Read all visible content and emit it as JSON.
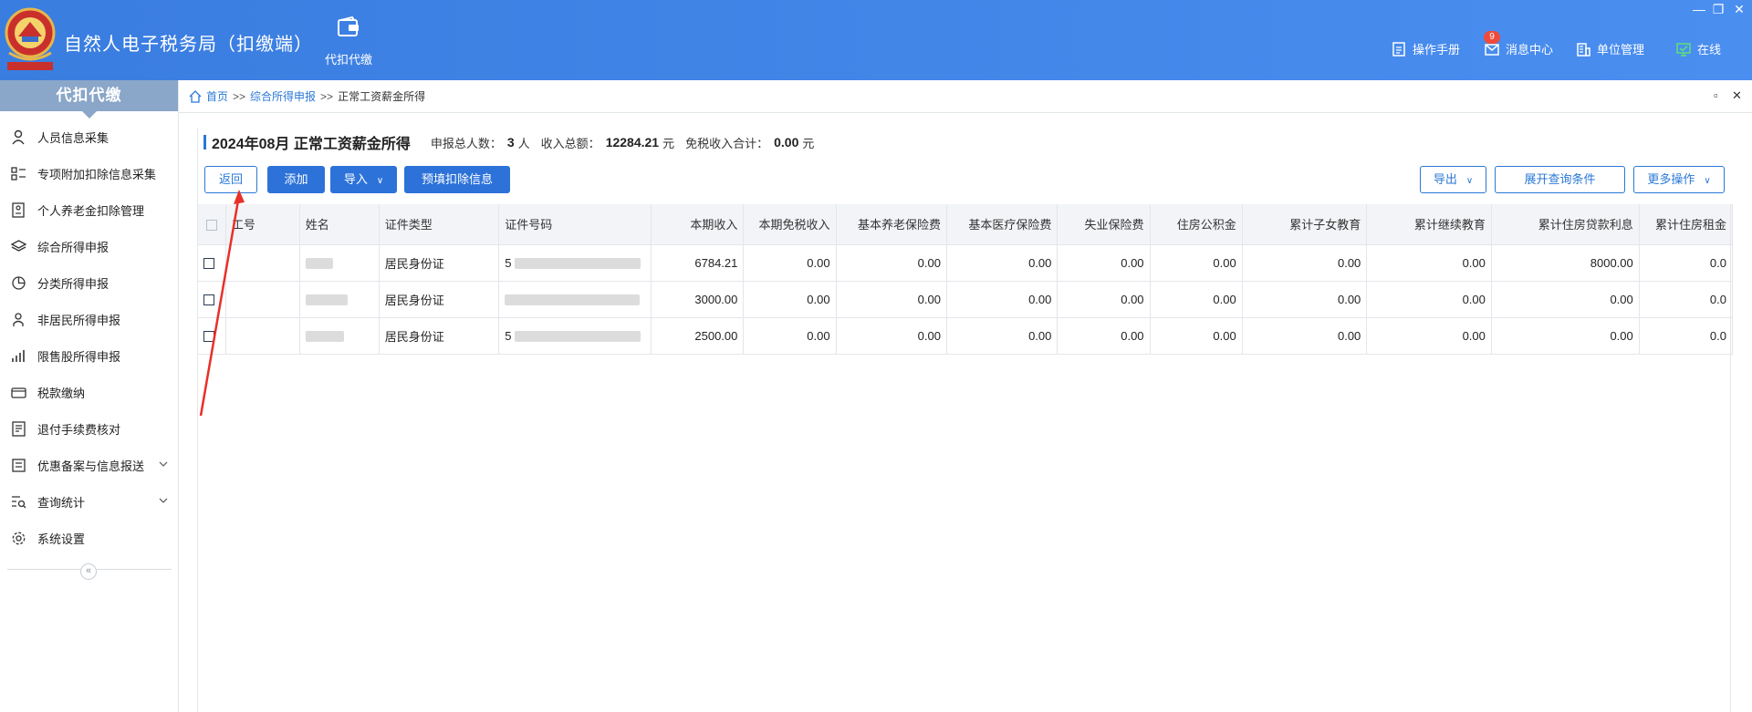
{
  "header": {
    "app_title": "自然人电子税务局（扣缴端）",
    "nav_tile_label": "代扣代缴",
    "links": {
      "manual": "操作手册",
      "messages": "消息中心",
      "unit": "单位管理",
      "online": "在线"
    },
    "message_badge": "9",
    "window_controls": {
      "minimize": "—",
      "restore": "❐",
      "close": "✕"
    }
  },
  "sidebar": {
    "title": "代扣代缴",
    "items": [
      {
        "label": "人员信息采集",
        "icon": "person-icon"
      },
      {
        "label": "专项附加扣除信息采集",
        "icon": "list-icon"
      },
      {
        "label": "个人养老金扣除管理",
        "icon": "pension-icon"
      },
      {
        "label": "综合所得申报",
        "icon": "layers-icon"
      },
      {
        "label": "分类所得申报",
        "icon": "pie-icon"
      },
      {
        "label": "非居民所得申报",
        "icon": "user-icon"
      },
      {
        "label": "限售股所得申报",
        "icon": "bar-chart-icon"
      },
      {
        "label": "税款缴纳",
        "icon": "wallet-icon"
      },
      {
        "label": "退付手续费核对",
        "icon": "checklist-icon"
      },
      {
        "label": "优惠备案与信息报送",
        "icon": "document-icon",
        "expandable": true
      },
      {
        "label": "查询统计",
        "icon": "search-list-icon",
        "expandable": true
      },
      {
        "label": "系统设置",
        "icon": "gear-icon"
      }
    ],
    "collapse_label": "«"
  },
  "breadcrumb": {
    "home": "首页",
    "sep": ">>",
    "level1": "综合所得申报",
    "current": "正常工资薪金所得",
    "ctl_restore": "▫",
    "ctl_close": "✕"
  },
  "summary": {
    "title": "2024年08月  正常工资薪金所得",
    "total_people_label": "申报总人数：",
    "total_people_value": "3",
    "total_people_unit": "人",
    "income_label": "收入总额：",
    "income_value": "12284.21",
    "income_unit": "元",
    "exempt_label": "免税收入合计：",
    "exempt_value": "0.00",
    "exempt_unit": "元"
  },
  "toolbar": {
    "back": "返回",
    "add": "添加",
    "import": "导入",
    "prefill": "预填扣除信息",
    "export": "导出",
    "expand_query": "展开查询条件",
    "more": "更多操作"
  },
  "table": {
    "headers": [
      "工号",
      "姓名",
      "证件类型",
      "证件号码",
      "本期收入",
      "本期免税收入",
      "基本养老保险费",
      "基本医疗保险费",
      "失业保险费",
      "住房公积金",
      "累计子女教育",
      "累计继续教育",
      "累计住房贷款利息",
      "累计住房租金"
    ],
    "rows": [
      {
        "id_type": "居民身份证",
        "id_prefix": "5",
        "income": "6784.21",
        "exempt": "0.00",
        "pension": "0.00",
        "medical": "0.00",
        "unemployment": "0.00",
        "housing_fund": "0.00",
        "child_edu": "0.00",
        "cont_edu": "0.00",
        "loan_interest": "8000.00",
        "rent": "0.0"
      },
      {
        "id_type": "居民身份证",
        "id_prefix": "",
        "income": "3000.00",
        "exempt": "0.00",
        "pension": "0.00",
        "medical": "0.00",
        "unemployment": "0.00",
        "housing_fund": "0.00",
        "child_edu": "0.00",
        "cont_edu": "0.00",
        "loan_interest": "0.00",
        "rent": "0.0"
      },
      {
        "id_type": "居民身份证",
        "id_prefix": "5",
        "income": "2500.00",
        "exempt": "0.00",
        "pension": "0.00",
        "medical": "0.00",
        "unemployment": "0.00",
        "housing_fund": "0.00",
        "child_edu": "0.00",
        "cont_edu": "0.00",
        "loan_interest": "0.00",
        "rent": "0.0"
      }
    ]
  },
  "colors": {
    "header_bg": "#4a8ef0",
    "primary": "#2d72d9",
    "sidebar_head": "#8aa6c8",
    "annotation_arrow": "#e8302a"
  }
}
